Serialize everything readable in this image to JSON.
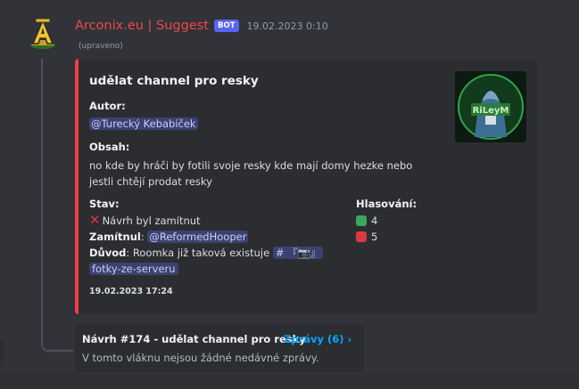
{
  "message": {
    "author": "Arconix.eu | Suggest",
    "bot_badge": "BOT",
    "timestamp": "19.02.2023 0:10",
    "edited": "(upraveno)"
  },
  "embed": {
    "accent_color": "#f23f43",
    "title": "udělat channel pro resky",
    "author_label": "Autor:",
    "author_mention": "@Turecký Kebabíček",
    "content_label": "Obsah:",
    "content_line1": "no kde by hráči by fotili svoje resky kde mají domy hezke nebo",
    "content_line2": "jestli chtějí prodat resky",
    "status_label": "Stav:",
    "status_icon": "cross-mark-icon",
    "status_text": "Návrh byl zamítnut",
    "rejected_label": "Zamítnul",
    "rejected_by": "@ReformedHooper",
    "reason_label": "Důvod",
    "reason_text": "Roomka již taková existuje",
    "channel_prefix": "# 『📷』",
    "channel_name": "fotky-ze-serveru",
    "votes_label": "Hlasování:",
    "upvotes": "4",
    "downvotes": "5",
    "footer_timestamp": "19.02.2023 17:24"
  },
  "thread": {
    "title": "Návrh #174 - udělat channel pro resky",
    "messages_link": "Zprávy (6) ›",
    "empty_text": "V tomto vláknu nejsou žádné nedávné zprávy."
  },
  "colors": {
    "background": "#313338",
    "embed_background": "#2b2d31",
    "username": "#f04747",
    "link": "#00a8fc",
    "mention_bg": "#3c4270"
  }
}
